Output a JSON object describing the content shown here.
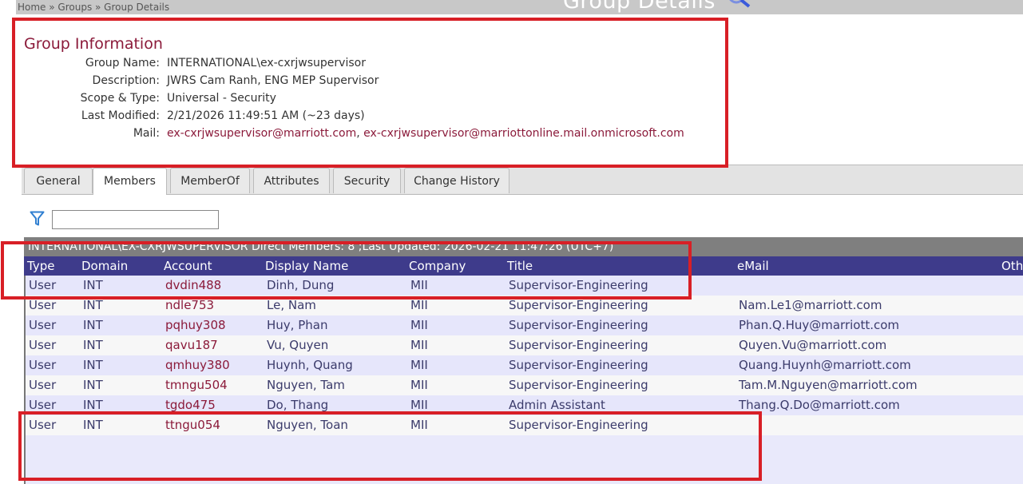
{
  "breadcrumb": "Home » Groups » Group Details",
  "page_title": "Group Details",
  "info": {
    "title": "Group Information",
    "rows": [
      {
        "label": "Group Name:",
        "value": "INTERNATIONAL\\ex-cxrjwsupervisor"
      },
      {
        "label": "Description:",
        "value": "JWRS Cam Ranh, ENG MEP Supervisor"
      },
      {
        "label": "Scope & Type:",
        "value": "Universal - Security"
      },
      {
        "label": "Last Modified:",
        "value": "2/21/2026 11:49:51 AM (~23 days)"
      }
    ],
    "mail_label": "Mail:",
    "mail_1": "ex-cxrjwsupervisor@marriott.com",
    "mail_sep": ", ",
    "mail_2": "ex-cxrjwsupervisor@marriottonline.mail.onmicrosoft.com"
  },
  "tabs": [
    {
      "label": "General",
      "active": false
    },
    {
      "label": "Members",
      "active": true
    },
    {
      "label": "MemberOf",
      "active": false
    },
    {
      "label": "Attributes",
      "active": false
    },
    {
      "label": "Security",
      "active": false
    },
    {
      "label": "Change History",
      "active": false
    }
  ],
  "filter": {
    "value": "",
    "icon": "filter-icon"
  },
  "grid": {
    "caption": "INTERNATIONAL\\EX-CXRJWSUPERVISOR Direct Members: 8 ;Last Updated: 2026-02-21 11:47:26 (UTC+7)",
    "columns": {
      "type": "Type",
      "domain": "Domain",
      "account": "Account",
      "display": "Display Name",
      "company": "Company",
      "title": "Title",
      "email": "eMail",
      "other": "Oth"
    },
    "rows": [
      {
        "type": "User",
        "domain": "INT",
        "account": "dvdin488",
        "display": "Dinh, Dung",
        "company": "MII",
        "title": "Supervisor-Engineering",
        "email": ""
      },
      {
        "type": "User",
        "domain": "INT",
        "account": "ndle753",
        "display": "Le, Nam",
        "company": "MII",
        "title": "Supervisor-Engineering",
        "email": "Nam.Le1@marriott.com"
      },
      {
        "type": "User",
        "domain": "INT",
        "account": "pqhuy308",
        "display": "Huy, Phan",
        "company": "MII",
        "title": "Supervisor-Engineering",
        "email": "Phan.Q.Huy@marriott.com"
      },
      {
        "type": "User",
        "domain": "INT",
        "account": "qavu187",
        "display": "Vu, Quyen",
        "company": "MII",
        "title": "Supervisor-Engineering",
        "email": "Quyen.Vu@marriott.com"
      },
      {
        "type": "User",
        "domain": "INT",
        "account": "qmhuy380",
        "display": "Huynh, Quang",
        "company": "MII",
        "title": "Supervisor-Engineering",
        "email": "Quang.Huynh@marriott.com"
      },
      {
        "type": "User",
        "domain": "INT",
        "account": "tmngu504",
        "display": "Nguyen, Tam",
        "company": "MII",
        "title": "Supervisor-Engineering",
        "email": "Tam.M.Nguyen@marriott.com"
      },
      {
        "type": "User",
        "domain": "INT",
        "account": "tgdo475",
        "display": "Do, Thang",
        "company": "MII",
        "title": "Admin Assistant",
        "email": "Thang.Q.Do@marriott.com"
      },
      {
        "type": "User",
        "domain": "INT",
        "account": "ttngu054",
        "display": "Nguyen, Toan",
        "company": "MII",
        "title": "Supervisor-Engineering",
        "email": ""
      }
    ]
  },
  "colors": {
    "accent": "#8b1a3a",
    "header_bg": "#3e3b8b",
    "highlight": "#d81f26"
  }
}
